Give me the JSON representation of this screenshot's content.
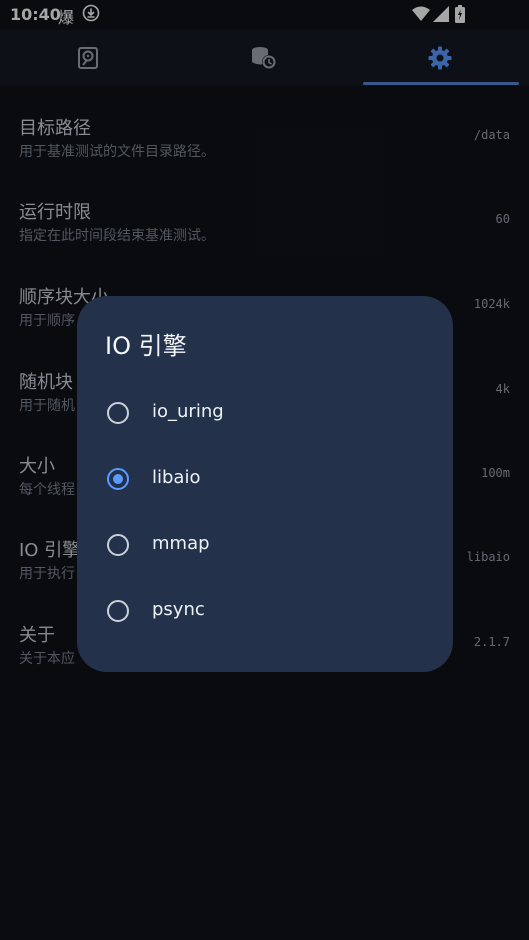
{
  "status": {
    "time": "10:40",
    "glyph": "爆",
    "icons": [
      "download-icon",
      "wifi-icon",
      "signal-icon",
      "battery-icon"
    ]
  },
  "tabs": [
    {
      "name": "tab-disk",
      "icon": "disk-icon"
    },
    {
      "name": "tab-history",
      "icon": "database-clock-icon"
    },
    {
      "name": "tab-settings",
      "icon": "gear-icon",
      "active": true
    }
  ],
  "settings": [
    {
      "title": "目标路径",
      "subtitle": "用于基准测试的文件目录路径。",
      "value": "/data"
    },
    {
      "title": "运行时限",
      "subtitle": "指定在此时间段结束基准测试。",
      "value": "60"
    },
    {
      "title": "顺序块大小",
      "subtitle": "用于顺序",
      "value": "1024k"
    },
    {
      "title": "随机块",
      "subtitle": "用于随机",
      "value": "4k"
    },
    {
      "title": "大小",
      "subtitle": "每个线程",
      "value": "100m"
    },
    {
      "title": "IO 引擎",
      "subtitle": "用于执行",
      "value": "libaio"
    },
    {
      "title": "关于",
      "subtitle": "关于本应",
      "value": "2.1.7"
    }
  ],
  "dialog": {
    "title": "IO 引擎",
    "options": [
      "io_uring",
      "libaio",
      "mmap",
      "psync"
    ],
    "selected": "libaio"
  },
  "colors": {
    "background": "#0f1218",
    "dialog": "#23324a",
    "accent": "#5b9bff"
  }
}
